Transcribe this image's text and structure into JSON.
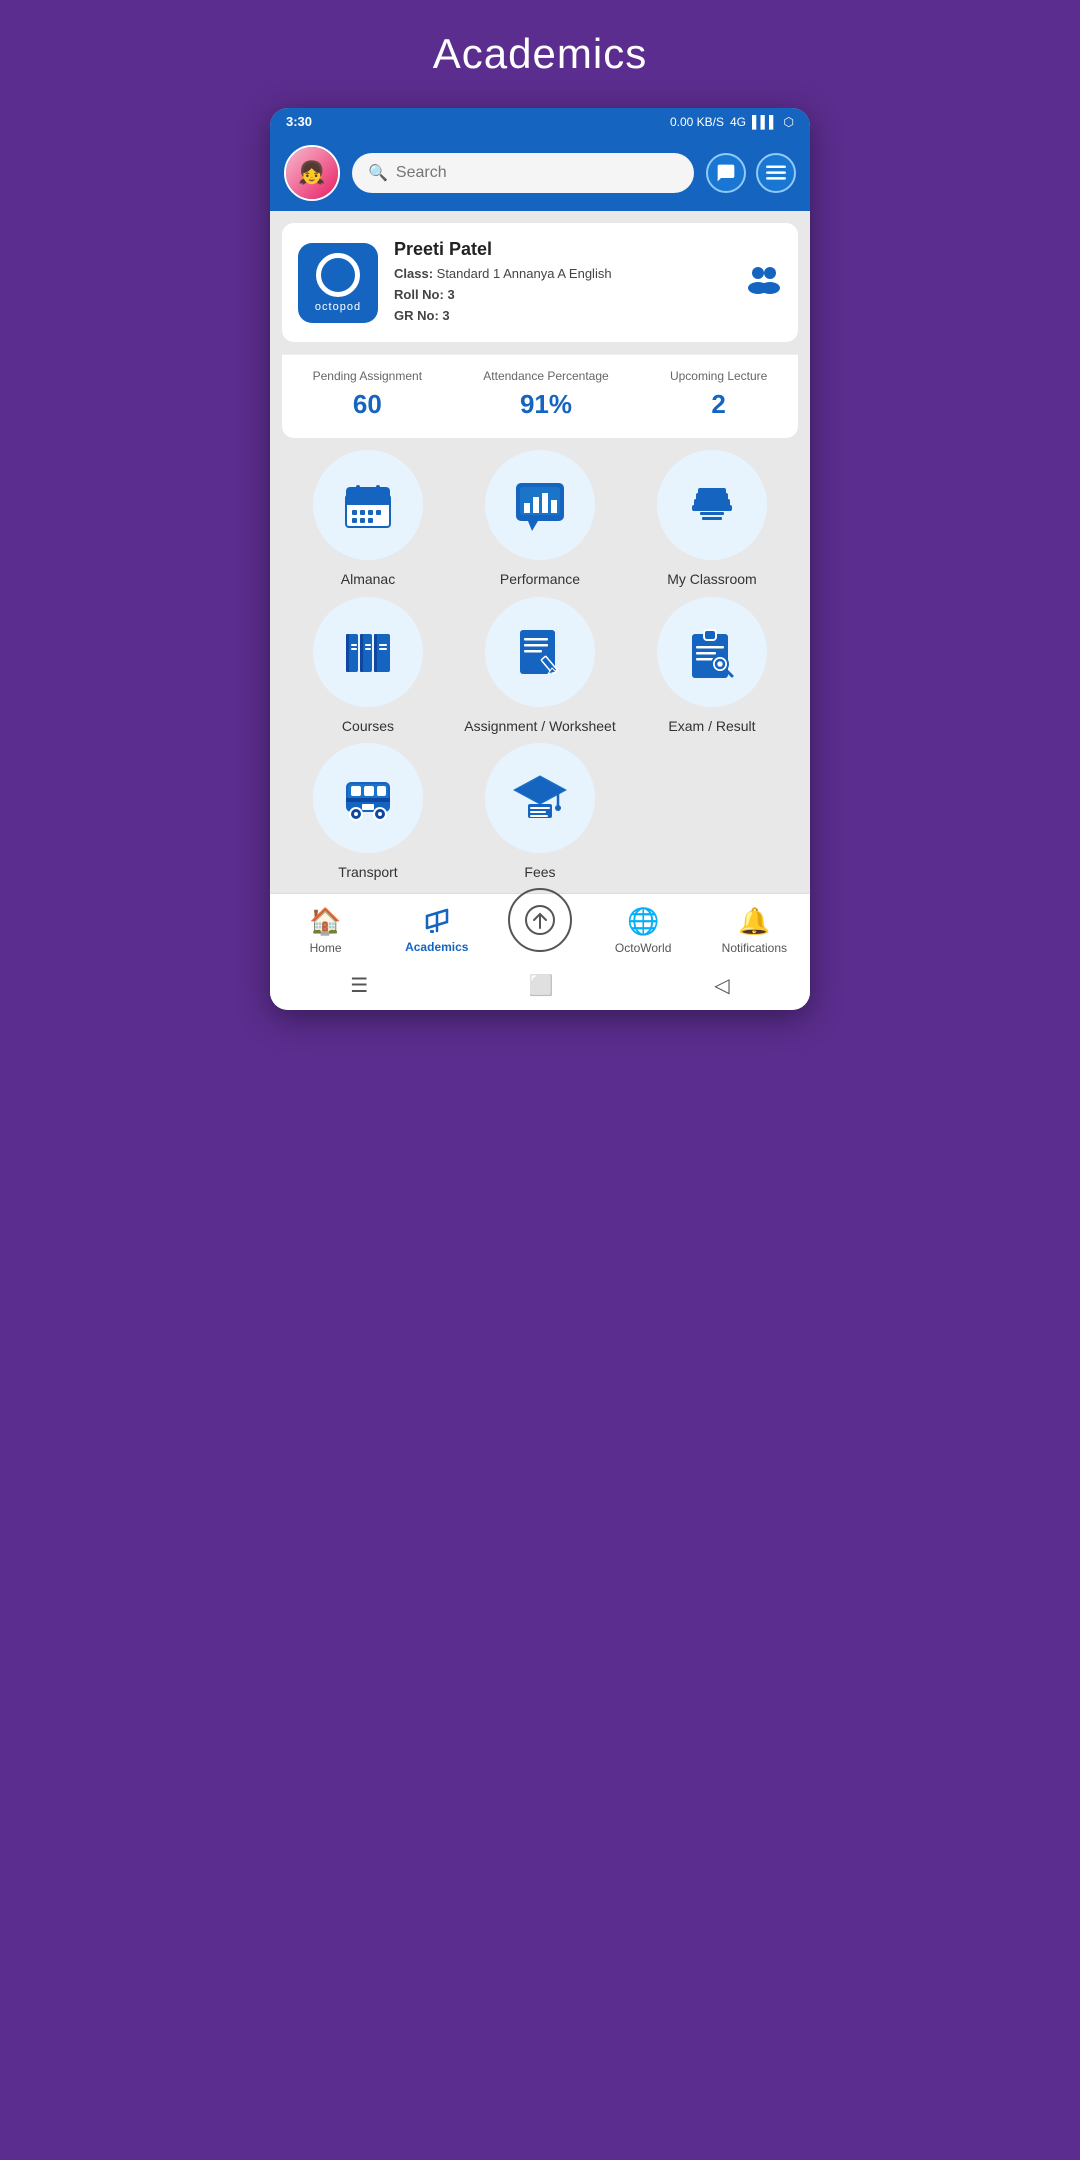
{
  "page": {
    "title": "Academics"
  },
  "statusBar": {
    "time": "3:30",
    "signal": "4G",
    "battery": "⬡"
  },
  "header": {
    "searchPlaceholder": "Search",
    "searchIcon": "🔍"
  },
  "profile": {
    "name": "Preeti Patel",
    "classLabel": "Class:",
    "classValue": "Standard 1 Annanya A English",
    "rollLabel": "Roll No:",
    "rollValue": "3",
    "grLabel": "GR No:",
    "grValue": "3",
    "logoText": "octopod"
  },
  "stats": [
    {
      "label": "Pending Assignment",
      "value": "60"
    },
    {
      "label": "Attendance Percentage",
      "value": "91%"
    },
    {
      "label": "Upcoming Lecture",
      "value": "2"
    }
  ],
  "gridItems": [
    {
      "id": "almanac",
      "label": "Almanac",
      "icon": "almanac"
    },
    {
      "id": "performance",
      "label": "Performance",
      "icon": "performance"
    },
    {
      "id": "my-classroom",
      "label": "My Classroom",
      "icon": "classroom"
    },
    {
      "id": "courses",
      "label": "Courses",
      "icon": "courses"
    },
    {
      "id": "assignment-worksheet",
      "label": "Assignment / Worksheet",
      "icon": "assignment"
    },
    {
      "id": "exam-result",
      "label": "Exam / Result",
      "icon": "exam"
    },
    {
      "id": "transport",
      "label": "Transport",
      "icon": "transport"
    },
    {
      "id": "fees",
      "label": "Fees",
      "icon": "fees"
    }
  ],
  "bottomNav": [
    {
      "id": "home",
      "label": "Home",
      "icon": "🏠",
      "active": false
    },
    {
      "id": "academics",
      "label": "Academics",
      "icon": "✏️",
      "active": true
    },
    {
      "id": "octoworld",
      "label": "OctoWorld",
      "icon": "🌐",
      "active": false
    },
    {
      "id": "notifications",
      "label": "Notifications",
      "icon": "🔔",
      "active": false
    }
  ]
}
